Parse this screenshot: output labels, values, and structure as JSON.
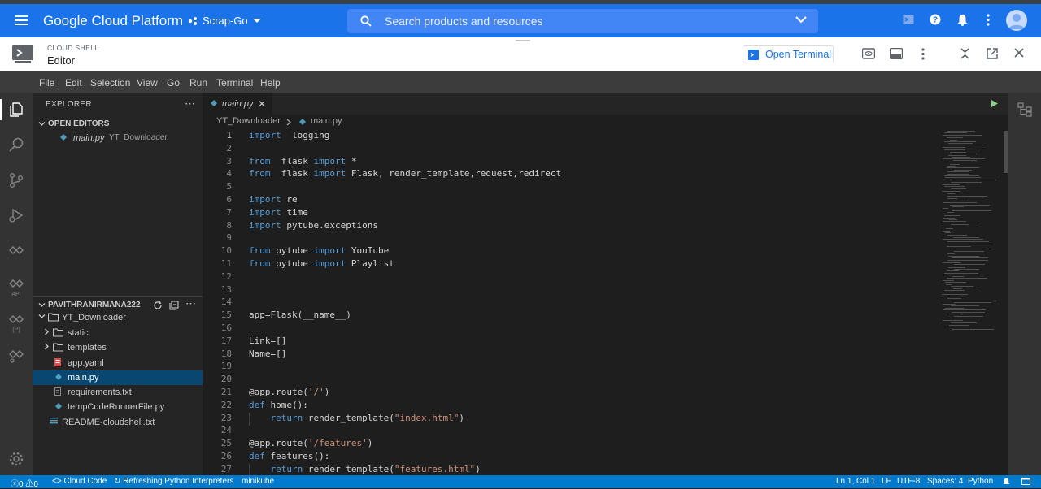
{
  "gcp": {
    "brand": "Google Cloud Platform",
    "project": "Scrap-Go",
    "search_placeholder": "Search products and resources"
  },
  "shell": {
    "section_label": "CLOUD SHELL",
    "title": "Editor",
    "open_terminal": "Open Terminal"
  },
  "menubar": [
    "File",
    "Edit",
    "Selection",
    "View",
    "Go",
    "Run",
    "Terminal",
    "Help"
  ],
  "explorer": {
    "title": "EXPLORER",
    "open_editors_title": "OPEN EDITORS",
    "open_editor_file": "main.py",
    "open_editor_folder": "YT_Downloader",
    "workspace_title": "PAVITHRANIRMANA222",
    "tree": [
      {
        "label": "YT_Downloader",
        "type": "folder-open"
      },
      {
        "label": "static",
        "type": "folder"
      },
      {
        "label": "templates",
        "type": "folder"
      },
      {
        "label": "app.yaml",
        "type": "yaml"
      },
      {
        "label": "main.py",
        "type": "python",
        "selected": true
      },
      {
        "label": "requirements.txt",
        "type": "text"
      },
      {
        "label": "tempCodeRunnerFile.py",
        "type": "python"
      },
      {
        "label": "README-cloudshell.txt",
        "type": "text"
      }
    ]
  },
  "tab": {
    "label": "main.py"
  },
  "breadcrumb": {
    "folder": "YT_Downloader",
    "file": "main.py"
  },
  "code": [
    {
      "n": "1",
      "t": [
        [
          "kw",
          "import"
        ],
        [
          "",
          "  logging"
        ]
      ]
    },
    {
      "n": "2",
      "t": []
    },
    {
      "n": "3",
      "t": [
        [
          "kw",
          "from"
        ],
        [
          "",
          "  flask "
        ],
        [
          "kw",
          "import"
        ],
        [
          "",
          " *"
        ]
      ]
    },
    {
      "n": "4",
      "t": [
        [
          "kw",
          "from"
        ],
        [
          "",
          "  flask "
        ],
        [
          "kw",
          "import"
        ],
        [
          "",
          " Flask, render_template,request,redirect"
        ]
      ]
    },
    {
      "n": "5",
      "t": []
    },
    {
      "n": "6",
      "t": [
        [
          "kw",
          "import"
        ],
        [
          "",
          " re"
        ]
      ]
    },
    {
      "n": "7",
      "t": [
        [
          "kw",
          "import"
        ],
        [
          "",
          " time"
        ]
      ]
    },
    {
      "n": "8",
      "t": [
        [
          "kw",
          "import"
        ],
        [
          "",
          " pytube.exceptions"
        ]
      ]
    },
    {
      "n": "9",
      "t": []
    },
    {
      "n": "10",
      "t": [
        [
          "kw",
          "from"
        ],
        [
          "",
          " pytube "
        ],
        [
          "kw",
          "import"
        ],
        [
          "",
          " YouTube"
        ]
      ]
    },
    {
      "n": "11",
      "t": [
        [
          "kw",
          "from"
        ],
        [
          "",
          " pytube "
        ],
        [
          "kw",
          "import"
        ],
        [
          "",
          " Playlist"
        ]
      ]
    },
    {
      "n": "12",
      "t": []
    },
    {
      "n": "13",
      "t": []
    },
    {
      "n": "14",
      "t": []
    },
    {
      "n": "15",
      "t": [
        [
          "",
          "app=Flask(__name__)"
        ]
      ]
    },
    {
      "n": "16",
      "t": []
    },
    {
      "n": "17",
      "t": [
        [
          "",
          "Link=[]"
        ]
      ]
    },
    {
      "n": "18",
      "t": [
        [
          "",
          "Name=[]"
        ]
      ]
    },
    {
      "n": "19",
      "t": []
    },
    {
      "n": "20",
      "t": []
    },
    {
      "n": "21",
      "t": [
        [
          "",
          "@app.route("
        ],
        [
          "str",
          "'/'"
        ],
        [
          "",
          ")"
        ]
      ]
    },
    {
      "n": "22",
      "t": [
        [
          "kw",
          "def"
        ],
        [
          "",
          " home():"
        ]
      ]
    },
    {
      "n": "23",
      "t": [
        [
          "",
          "    "
        ],
        [
          "kw",
          "return"
        ],
        [
          "",
          " render_template("
        ],
        [
          "str",
          "\"index.html\""
        ],
        [
          "",
          ")"
        ]
      ]
    },
    {
      "n": "24",
      "t": []
    },
    {
      "n": "25",
      "t": [
        [
          "",
          "@app.route("
        ],
        [
          "str",
          "'/features'"
        ],
        [
          "",
          ")"
        ]
      ]
    },
    {
      "n": "26",
      "t": [
        [
          "kw",
          "def"
        ],
        [
          "",
          " features():"
        ]
      ]
    },
    {
      "n": "27",
      "t": [
        [
          "",
          "    "
        ],
        [
          "kw",
          "return"
        ],
        [
          "",
          " render_template("
        ],
        [
          "str",
          "\"features.html\""
        ],
        [
          "",
          ")"
        ]
      ]
    }
  ],
  "status": {
    "errors": "0",
    "warnings": "0",
    "cloud_code": "Cloud Code",
    "task": "Refreshing Python Interpreters",
    "cluster": "minikube",
    "position": "Ln 1, Col 1",
    "eol": "LF",
    "encoding": "UTF-8",
    "spaces": "Spaces: 4",
    "language": "Python"
  }
}
